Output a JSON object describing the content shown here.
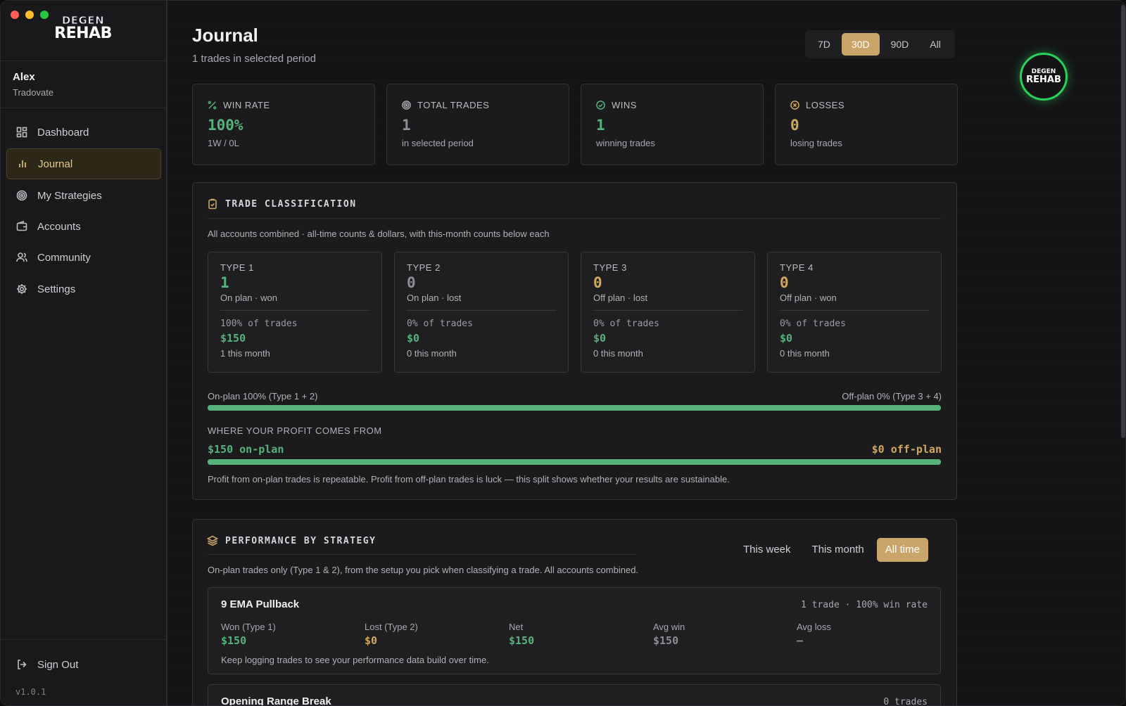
{
  "logo": {
    "line1": "DEGEN",
    "line2": "REHAB"
  },
  "user": {
    "name": "Alex",
    "broker": "Tradovate"
  },
  "nav": [
    {
      "label": "Dashboard",
      "icon": "dashboard-icon"
    },
    {
      "label": "Journal",
      "icon": "bar-chart-icon"
    },
    {
      "label": "My Strategies",
      "icon": "target-icon"
    },
    {
      "label": "Accounts",
      "icon": "wallet-icon"
    },
    {
      "label": "Community",
      "icon": "users-icon"
    },
    {
      "label": "Settings",
      "icon": "gear-icon"
    }
  ],
  "signout": "Sign Out",
  "version": "v1.0.1",
  "header": {
    "title": "Journal",
    "subtitle": "1 trades in selected period"
  },
  "period_tabs": [
    "7D",
    "30D",
    "90D",
    "All"
  ],
  "period_active": "30D",
  "stats": [
    {
      "label": "WIN RATE",
      "value": "100%",
      "sub": "1W / 0L",
      "icon": "percent-icon",
      "color": "#57b17b"
    },
    {
      "label": "TOTAL TRADES",
      "value": "1",
      "sub": "in selected period",
      "icon": "target-icon",
      "color": "#8d8d92"
    },
    {
      "label": "WINS",
      "value": "1",
      "sub": "winning trades",
      "icon": "check-circle-icon",
      "color": "#57b17b"
    },
    {
      "label": "LOSSES",
      "value": "0",
      "sub": "losing trades",
      "icon": "x-circle-icon",
      "color": "#d0a85c"
    }
  ],
  "classification": {
    "title": "TRADE CLASSIFICATION",
    "description": "All accounts combined · all-time counts & dollars, with this-month counts below each",
    "types": [
      {
        "label": "TYPE 1",
        "count": "1",
        "desc": "On plan · won",
        "pct": "100% of trades",
        "dollars": "$150",
        "month": "1 this month",
        "color": "#57b17b"
      },
      {
        "label": "TYPE 2",
        "count": "0",
        "desc": "On plan · lost",
        "pct": "0% of trades",
        "dollars": "$0",
        "month": "0 this month",
        "color": "#8d8d92"
      },
      {
        "label": "TYPE 3",
        "count": "0",
        "desc": "Off plan · lost",
        "pct": "0% of trades",
        "dollars": "$0",
        "month": "0 this month",
        "color": "#d0a85c"
      },
      {
        "label": "TYPE 4",
        "count": "0",
        "desc": "Off plan · won",
        "pct": "0% of trades",
        "dollars": "$0",
        "month": "0 this month",
        "color": "#d0a85c"
      }
    ],
    "onplan_label": "On-plan 100% (Type 1 + 2)",
    "offplan_label": "Off-plan 0% (Type 3 + 4)",
    "onplan_fraction": 1.0,
    "profit_heading": "WHERE YOUR PROFIT COMES FROM",
    "profit_onplan": "$150 on-plan",
    "profit_offplan": "$0 off-plan",
    "profit_fraction": 1.0,
    "profit_note": "Profit from on-plan trades is repeatable. Profit from off-plan trades is luck — this split shows whether your results are sustainable."
  },
  "performance": {
    "title": "PERFORMANCE BY STRATEGY",
    "description": "On-plan trades only (Type 1 & 2), from the setup you pick when classifying a trade. All accounts combined.",
    "tabs": [
      "This week",
      "This month",
      "All time"
    ],
    "active_tab": "All time",
    "strategies": [
      {
        "name": "9 EMA Pullback",
        "meta": "1 trade · 100% win rate",
        "cols": [
          {
            "label": "Won (Type 1)",
            "value": "$150"
          },
          {
            "label": "Lost (Type 2)",
            "value": "$0"
          },
          {
            "label": "Net",
            "value": "$150"
          },
          {
            "label": "Avg win",
            "value": "$150"
          },
          {
            "label": "Avg loss",
            "value": "—"
          }
        ],
        "note": "Keep logging trades to see your performance data build over time."
      },
      {
        "name": "Opening Range Break",
        "meta": "0 trades"
      }
    ]
  }
}
